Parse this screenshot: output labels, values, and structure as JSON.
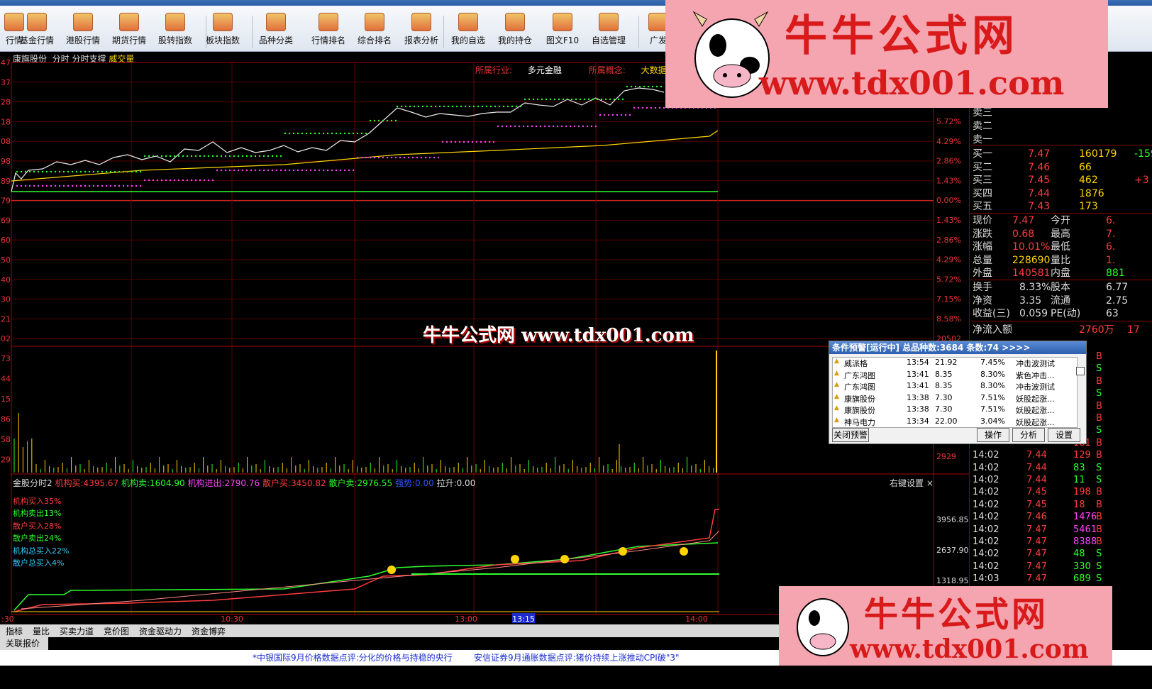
{
  "toolbar": {
    "items": [
      "行情",
      "基金行情",
      "港股行情",
      "期货行情",
      "股转指数",
      "板块指数",
      "品种分类",
      "行情排名",
      "综合排名",
      "报表分析",
      "我的自选",
      "我的持仓",
      "图文F10",
      "自选管理",
      "广发"
    ]
  },
  "chart": {
    "stock_name": "康旗股份",
    "mode": "分时",
    "indicator": "分时支撑",
    "volume_label": "威交量",
    "industry_label": "所属行业:",
    "industry_value": "多元金融",
    "concept_label": "所属概念:",
    "concept_value": "大数据",
    "left_price_ticks": [
      "47",
      "37",
      "28",
      "18",
      "08",
      "98",
      "89",
      "79",
      "69",
      "60",
      "50",
      "40",
      "30",
      "21",
      "02"
    ],
    "right_pct_ticks": [
      "5.72%",
      "4.29%",
      "2.86%",
      "1.43%",
      "0.00%",
      "1.43%",
      "2.86%",
      "4.29%",
      "5.72%",
      "7.15%",
      "8.58%"
    ],
    "vol_left_ticks": [
      "73",
      "44",
      "15",
      "86",
      "58",
      "29"
    ],
    "vol_right_ticks": [
      "20502",
      "2929"
    ],
    "time_ticks": [
      ":30",
      "10:30",
      "13:00",
      "13:15",
      "14:00"
    ]
  },
  "indicator_panel": {
    "name": "金股分时2",
    "jg_buy_label": "机构买:",
    "jg_buy": "4395.67",
    "jg_sell_label": "机构卖:",
    "jg_sell": "1604.90",
    "jg_net_label": "机构进出:",
    "jg_net": "2790.76",
    "sh_buy_label": "散户买:",
    "sh_buy": "3450.82",
    "sh_sell_label": "散户卖:",
    "sh_sell": "2976.55",
    "trend_label": "强势:",
    "trend": "0.00",
    "pull_label": "拉升:",
    "pull": "0.00",
    "settings": "右键设置",
    "pct_lines": [
      {
        "text": "机构买入35%",
        "color": "#ff3c3c"
      },
      {
        "text": "机构卖出13%",
        "color": "#2dff2d"
      },
      {
        "text": "散户买入28%",
        "color": "#ff3c3c"
      },
      {
        "text": "散户卖出24%",
        "color": "#2dff2d"
      },
      {
        "text": "机构总买入22%",
        "color": "#33ccff"
      },
      {
        "text": "散户总买入4%",
        "color": "#33ccff"
      }
    ],
    "right_ticks": [
      "3956.85",
      "2637.90",
      "1318.95"
    ]
  },
  "quote": {
    "asks": [
      "卖三",
      "卖二",
      "卖一"
    ],
    "bids": [
      {
        "label": "买一",
        "price": "7.47",
        "vol": "160179",
        "extra": "-159"
      },
      {
        "label": "买二",
        "price": "7.46",
        "vol": "66",
        "extra": ""
      },
      {
        "label": "买三",
        "price": "7.45",
        "vol": "462",
        "extra": "+3"
      },
      {
        "label": "买四",
        "price": "7.44",
        "vol": "1876",
        "extra": ""
      },
      {
        "label": "买五",
        "price": "7.43",
        "vol": "173",
        "extra": ""
      }
    ],
    "stats": [
      {
        "l1": "现价",
        "v1": "7.47",
        "l2": "今开",
        "v2": "6."
      },
      {
        "l1": "涨跌",
        "v1": "0.68",
        "l2": "最高",
        "v2": "7."
      },
      {
        "l1": "涨幅",
        "v1": "10.01%",
        "l2": "最低",
        "v2": "6."
      },
      {
        "l1": "总量",
        "v1": "228690",
        "l2": "量比",
        "v2": "1."
      },
      {
        "l1": "外盘",
        "v1": "140581",
        "l2": "内盘",
        "v2": "881"
      }
    ],
    "fund": [
      {
        "l1": "换手",
        "v1": "8.33%",
        "l2": "股本",
        "v2": "6.77"
      },
      {
        "l1": "净资",
        "v1": "3.35",
        "l2": "流通",
        "v2": "2.75"
      },
      {
        "l1": "收益(三)",
        "v1": "0.059",
        "l2": "PE(动)",
        "v2": "63"
      }
    ],
    "net_inflow_label": "净流入额",
    "net_inflow": "2760万",
    "net_inflow_extra": "17"
  },
  "ticks": [
    {
      "t": "",
      "p": "",
      "v": "",
      "s": "B"
    },
    {
      "t": "",
      "p": "",
      "v": "",
      "s": "S"
    },
    {
      "t": "",
      "p": "",
      "v": "",
      "s": "B"
    },
    {
      "t": "",
      "p": "",
      "v": "",
      "s": "S"
    },
    {
      "t": "",
      "p": "",
      "v": "",
      "s": "B"
    },
    {
      "t": "",
      "p": "",
      "v": "",
      "s": "B"
    },
    {
      "t": "",
      "p": "",
      "v": "",
      "s": "S"
    },
    {
      "t": "",
      "p": "",
      "v": "181",
      "s": "B"
    },
    {
      "t": "14:02",
      "p": "7.44",
      "v": "129",
      "s": "B"
    },
    {
      "t": "14:02",
      "p": "7.44",
      "v": "83",
      "s": "S"
    },
    {
      "t": "14:02",
      "p": "7.44",
      "v": "11",
      "s": "S"
    },
    {
      "t": "14:02",
      "p": "7.45",
      "v": "198",
      "s": "B"
    },
    {
      "t": "14:02",
      "p": "7.45",
      "v": "18",
      "s": "B"
    },
    {
      "t": "14:02",
      "p": "7.46",
      "v": "1476",
      "s": "B"
    },
    {
      "t": "14:02",
      "p": "7.47",
      "v": "5461",
      "s": "B"
    },
    {
      "t": "14:02",
      "p": "7.47",
      "v": "8388",
      "s": "B"
    },
    {
      "t": "14:02",
      "p": "7.47",
      "v": "48",
      "s": "S"
    },
    {
      "t": "14:02",
      "p": "7.47",
      "v": "330",
      "s": "S"
    },
    {
      "t": "14:03",
      "p": "7.47",
      "v": "689",
      "s": "S"
    }
  ],
  "alert": {
    "title": "条件预警[运行中] 总品种数:3684 条数:74 >>>>",
    "rows": [
      {
        "name": "威派格",
        "time": "13:54",
        "price": "21.92",
        "pct": "7.45%",
        "cond": "冲击波测试"
      },
      {
        "name": "广东鸿图",
        "time": "13:41",
        "price": "8.35",
        "pct": "8.30%",
        "cond": "紫色冲击..."
      },
      {
        "name": "广东鸿图",
        "time": "13:41",
        "price": "8.35",
        "pct": "8.30%",
        "cond": "冲击波测试"
      },
      {
        "name": "康旗股份",
        "time": "13:38",
        "price": "7.30",
        "pct": "7.51%",
        "cond": "妖股起涨..."
      },
      {
        "name": "康旗股份",
        "time": "13:38",
        "price": "7.30",
        "pct": "7.51%",
        "cond": "妖股起涨..."
      },
      {
        "name": "神马电力",
        "time": "13:34",
        "price": "22.00",
        "pct": "3.04%",
        "cond": "妖股起涨..."
      }
    ],
    "close_btn": "关闭预警",
    "op_btn": "操作",
    "analyze_btn": "分析",
    "settings_btn": "设置"
  },
  "bottom_tabs": [
    "指标",
    "量比",
    "买卖力道",
    "竞价图",
    "资金驱动力",
    "资金博弈"
  ],
  "related_quote": "关联报价",
  "news": [
    "*中银国际9月价格数据点评:分化的价格与持稳的央行",
    "安信证券9月通胀数据点评:猪价持续上涨推动CPI破\"3\""
  ],
  "watermark": {
    "brand": "牛牛公式网",
    "url": "www.tdx001.com",
    "center": "牛牛公式网 www.tdx001.com"
  },
  "colors": {
    "up": "#ff3c3c",
    "down": "#2dff2d",
    "avg": "#ffd400",
    "accent": "#e33"
  }
}
